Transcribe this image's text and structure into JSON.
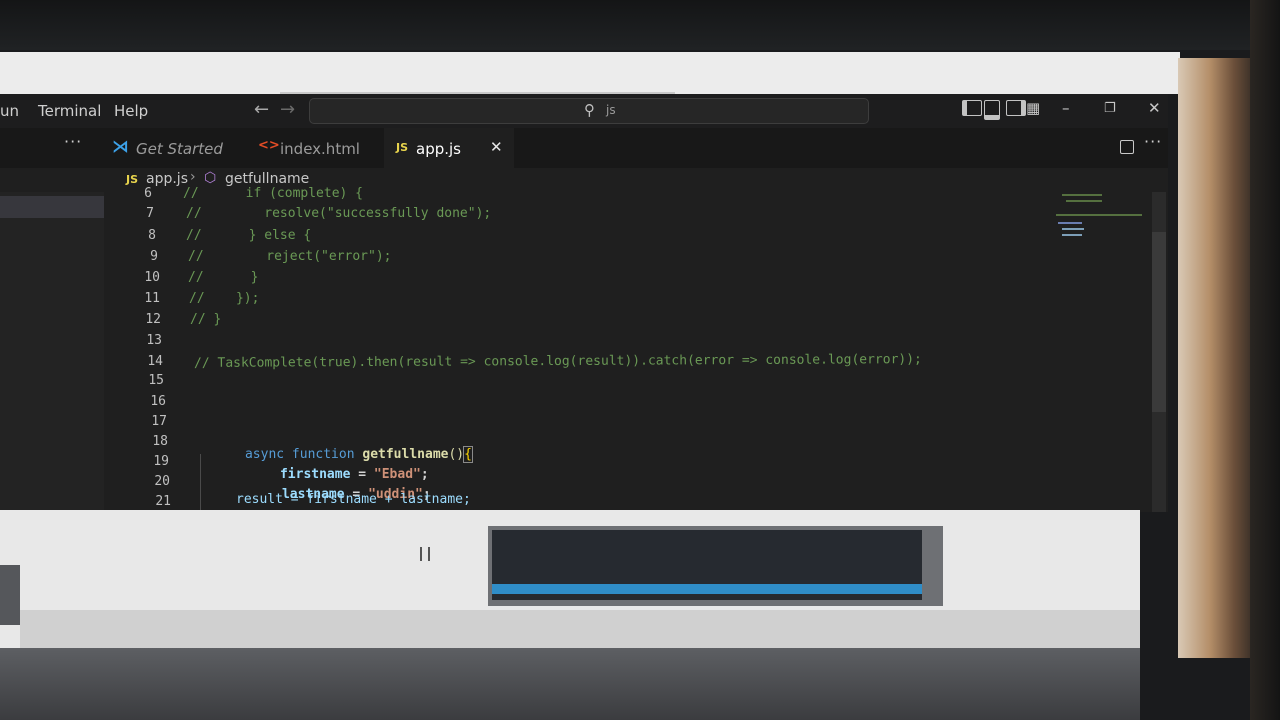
{
  "menu": {
    "run_partial": "un",
    "terminal": "Terminal",
    "help": "Help"
  },
  "search": {
    "text": "js"
  },
  "tabs": [
    {
      "label": "Get Started",
      "icon": "vscode-icon"
    },
    {
      "label": "index.html",
      "icon": "html-icon"
    },
    {
      "label": "app.js",
      "icon": "js-icon",
      "badge": "JS",
      "active": true
    }
  ],
  "breadcrumb": {
    "badge": "JS",
    "file": "app.js",
    "symbol": "getfullname"
  },
  "code": {
    "line_numbers": [
      "6",
      "7",
      "8",
      "9",
      "10",
      "11",
      "12",
      "13",
      "14",
      "15",
      "16",
      "17",
      "18",
      "19",
      "20",
      "21"
    ],
    "l6": "//      if (complete) {",
    "l7": "//        resolve(\"successfully done\");",
    "l8": "//      } else {",
    "l9": "//        reject(\"error\");",
    "l10": "//      }",
    "l11": "//    });",
    "l12": "// }",
    "l15": "// TaskComplete(true).then(result => console.log(result)).catch(error => console.log(error));",
    "l18_kw": "async function ",
    "l18_fn": "getfullname",
    "l18_par": "()",
    "l18_br": "{",
    "l19_var": "firstname",
    "l19_eq": " = ",
    "l19_str": "\"Ebad\"",
    "l19_end": ";",
    "l20_var": "lastname",
    "l20_eq": " = ",
    "l20_str": "\"uddin\"",
    "l20_end": ";",
    "l21": "result = firstname + lastname;"
  },
  "colors": {
    "comment": "#6a9955",
    "keyword": "#569cd6",
    "function": "#dcdcaa",
    "string": "#ce9178",
    "variable": "#9cdcfe",
    "statusbar": "#2f8dc8"
  }
}
